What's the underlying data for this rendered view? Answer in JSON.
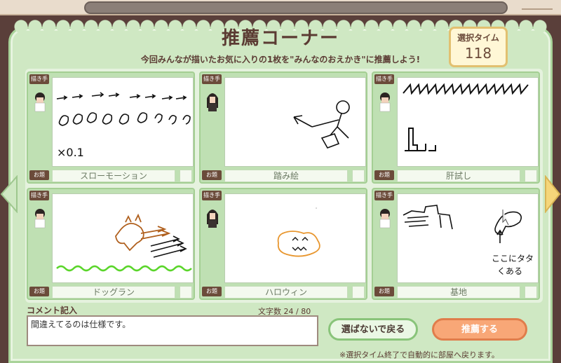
{
  "header": {
    "title": "推薦コーナー",
    "subtitle": "今回みんなが描いたお気に入りの1枚を\"みんなのおえかき\"に推薦しよう!"
  },
  "timer": {
    "label": "選択タイム",
    "value": "118"
  },
  "cards": [
    {
      "artist_label": "描き手",
      "topic_label": "お題",
      "topic": "スローモーション"
    },
    {
      "artist_label": "描き手",
      "topic_label": "お題",
      "topic": "踏み絵"
    },
    {
      "artist_label": "描き手",
      "topic_label": "お題",
      "topic": "肝試し"
    },
    {
      "artist_label": "描き手",
      "topic_label": "お題",
      "topic": "ドッグラン"
    },
    {
      "artist_label": "描き手",
      "topic_label": "お題",
      "topic": "ハロウィン"
    },
    {
      "artist_label": "描き手",
      "topic_label": "お題",
      "topic": "基地"
    }
  ],
  "drawing_text": {
    "slowmo_caption": "×0.1",
    "base_caption_1": "ここにタタ",
    "base_caption_2": "くある"
  },
  "comment": {
    "label": "コメント記入",
    "char_count": "文字数 24 / 80",
    "value": "間違えてるのは仕様です。"
  },
  "buttons": {
    "skip": "選ばないで戻る",
    "recommend": "推薦する"
  },
  "footnote": "※選択タイム終了で自動的に部屋へ戻ります。"
}
